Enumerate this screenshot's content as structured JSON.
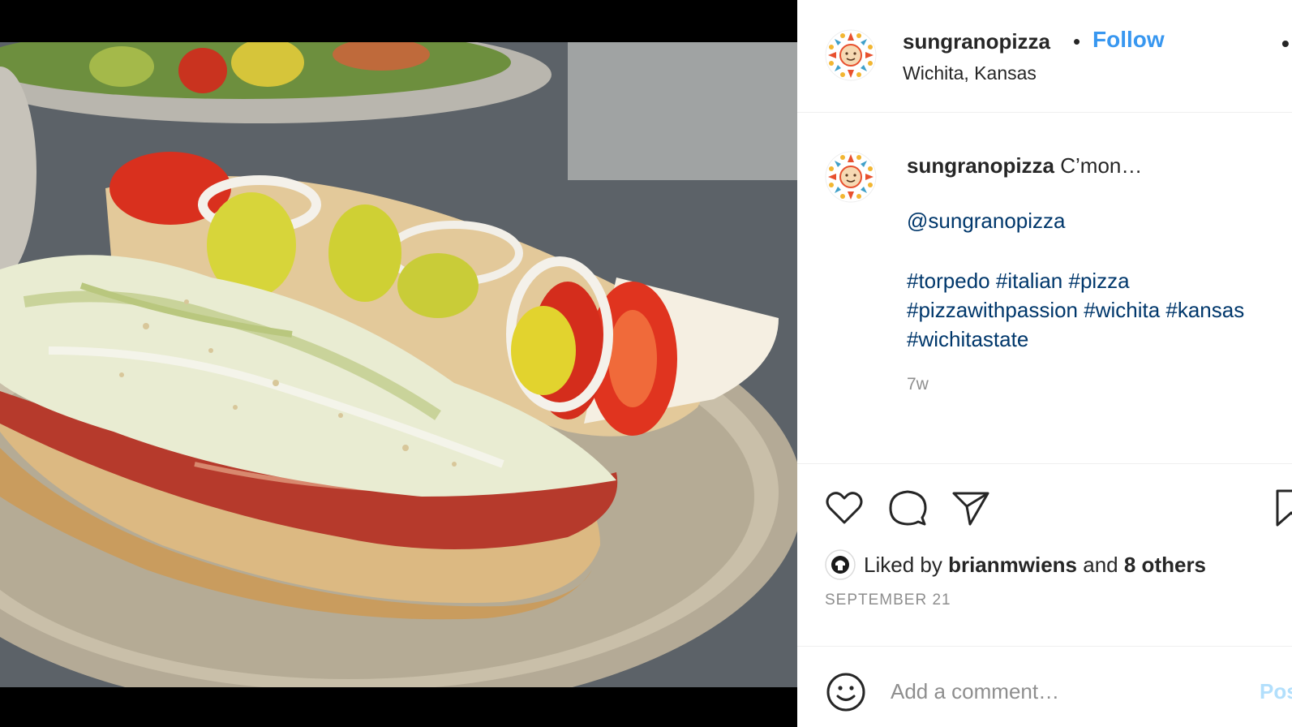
{
  "post": {
    "image_alt": "Torpedo sandwich with salami, provolone, tomato, peppers, onion and shredded lettuce on a metal tray"
  },
  "header": {
    "username": "sungranopizza",
    "separator": "•",
    "follow_label": "Follow",
    "location": "Wichita, Kansas",
    "more_label": "•",
    "more_icon": "more-options-icon"
  },
  "caption": {
    "username": "sungranopizza",
    "text": "C’mon…",
    "mention": "@sungranopizza",
    "hashtags_line1": "#torpedo #italian #pizza",
    "hashtags_line2": "#pizzawithpassion #wichita #kansas",
    "hashtags_line3": "#wichitastate",
    "age": "7w"
  },
  "actions": {
    "icons": [
      "heart-icon",
      "comment-icon",
      "share-icon",
      "bookmark-icon"
    ],
    "liked_by_prefix": "Liked by",
    "liked_by_user": "brianmwiens",
    "liked_by_and": "and",
    "liked_by_others": "8 others",
    "date": "SEPTEMBER 21"
  },
  "comment_box": {
    "placeholder": "Add a comment…",
    "post_label": "Post"
  },
  "colors": {
    "accent": "#3897f0",
    "link": "#00376b",
    "muted": "#8e8e8e",
    "post_disabled": "#b2dffc"
  }
}
